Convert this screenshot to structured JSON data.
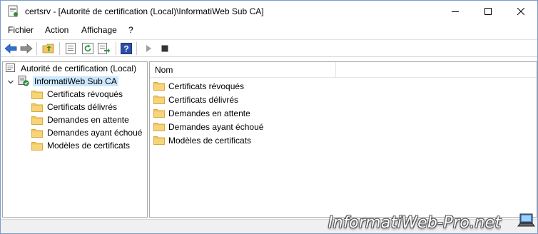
{
  "window": {
    "title": "certsrv - [Autorité de certification (Local)\\InformatiWeb Sub CA]"
  },
  "menu": {
    "items": [
      "Fichier",
      "Action",
      "Affichage",
      "?"
    ]
  },
  "toolbar": {
    "icons": [
      "back-arrow-icon",
      "forward-arrow-icon",
      "up-folder-icon",
      "properties-icon",
      "refresh-icon",
      "export-list-icon",
      "help-icon",
      "start-service-icon",
      "stop-service-icon"
    ]
  },
  "tree": {
    "root": "Autorité de certification (Local)",
    "ca": "InformatiWeb Sub CA",
    "children": [
      "Certificats révoqués",
      "Certificats délivrés",
      "Demandes en attente",
      "Demandes ayant échoué",
      "Modèles de certificats"
    ]
  },
  "list": {
    "column_header": "Nom",
    "items": [
      "Certificats révoqués",
      "Certificats délivrés",
      "Demandes en attente",
      "Demandes ayant échoué",
      "Modèles de certificats"
    ]
  },
  "watermark": {
    "text": "InformatiWeb-Pro.net"
  },
  "colors": {
    "selection": "#cce8ff",
    "folder": "#f0c75e",
    "folder_dark": "#d9a93d",
    "toolbar_arrow": "#2e6fcb"
  }
}
